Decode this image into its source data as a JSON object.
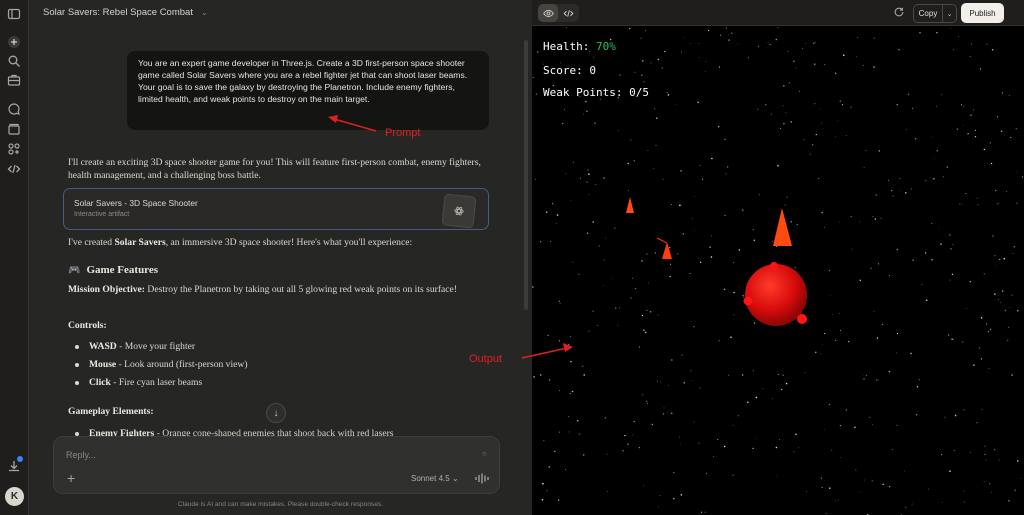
{
  "window": {
    "title": "Solar Savers: Rebel Space Combat"
  },
  "rail": {
    "icons": [
      "sidebar-toggle-icon",
      "new-chat-icon",
      "search-icon",
      "briefcase-icon",
      "chat-bubble-icon",
      "folder-icon",
      "apps-grid-icon",
      "code-icon",
      "download-icon"
    ],
    "avatar_initial": "K"
  },
  "prompt": {
    "text": "You are an expert game developer in Three.js. Create a 3D first-person space shooter game called Solar Savers where you are a rebel fighter jet that can shoot laser beams. Your goal is to save the galaxy by destroying the Planetron. Include enemy fighters, limited health, and weak points to destroy on the main target."
  },
  "response": {
    "intro": "I'll create an exciting 3D space shooter game for you! This will feature first-person combat, enemy fighters, health management, and a challenging boss battle.",
    "artifact_title": "Solar Savers - 3D Space Shooter",
    "artifact_subtitle": "Interactive artifact",
    "created_prefix": "I've created ",
    "created_bold": "Solar Savers",
    "created_suffix": ", an immersive 3D space shooter! Here's what you'll experience:",
    "features_heading": "Game Features",
    "mission_label": "Mission Objective:",
    "mission_text": " Destroy the Planetron by taking out all 5 glowing red weak points on its surface!",
    "controls_heading": "Controls:",
    "controls": [
      {
        "key": "WASD",
        "desc": " - Move your fighter"
      },
      {
        "key": "Mouse",
        "desc": " - Look around (first-person view)"
      },
      {
        "key": "Click",
        "desc": " - Fire cyan laser beams"
      }
    ],
    "gameplay_heading": "Gameplay Elements:",
    "enemy_label": "Enemy Fighters",
    "enemy_text": " - Orange cone-shaped enemies that shoot back with red lasers"
  },
  "composer": {
    "placeholder": "Reply...",
    "model": "Sonnet 4.5",
    "disclaimer": "Claude is AI and can make mistakes. Please double-check responses."
  },
  "preview_toolbar": {
    "copy_label": "Copy",
    "publish_label": "Publish"
  },
  "game_hud": {
    "health_label": "Health:",
    "health_value": "70%",
    "score_label": "Score:",
    "score_value": "0",
    "weak_label": "Weak Points:",
    "weak_value": "0/5"
  },
  "annotations": {
    "prompt_label": "Prompt",
    "output_label": "Output"
  },
  "colors": {
    "health_green": "#22c55e",
    "annotation_red": "#e02020",
    "planet_red": "#e01010",
    "enemy_orange": "#ff4a10"
  }
}
